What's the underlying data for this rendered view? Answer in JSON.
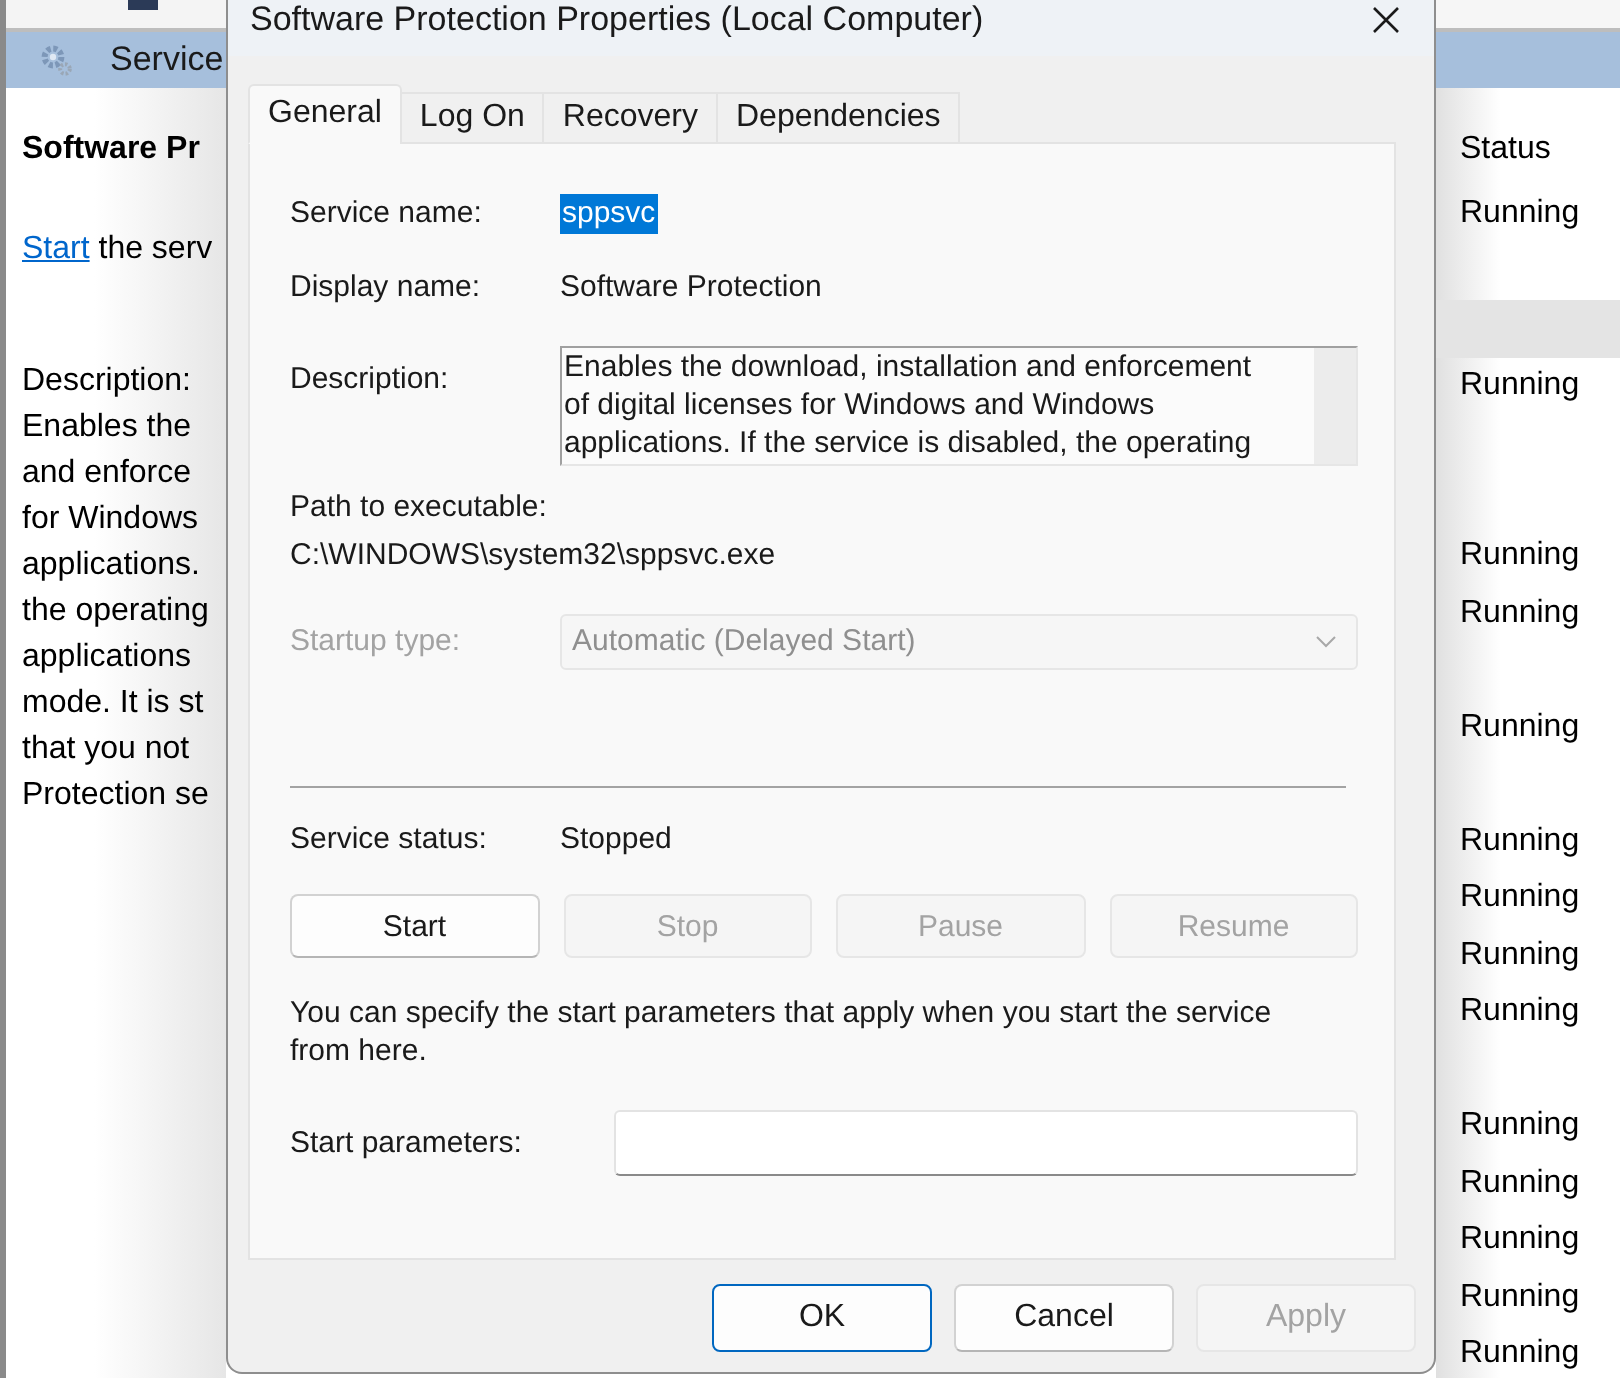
{
  "services_window": {
    "header": "Service",
    "selected_service": "Software Pr",
    "action": {
      "link": "Start",
      "text": "the serv"
    },
    "description_label": "Description:",
    "description_lines": [
      "Enables the",
      "and enforce",
      "for Windows",
      "applications.",
      "the operating",
      "applications",
      "mode. It is st",
      "that you not",
      "Protection se"
    ],
    "status_column": {
      "header": "Status",
      "rows": [
        {
          "status": "Running",
          "selected": false
        },
        {
          "selected": false
        },
        {
          "selected": true
        },
        {
          "status": "Running",
          "selected": false
        },
        {
          "selected": false
        },
        {
          "selected": false
        },
        {
          "status": "Running",
          "selected": false
        },
        {
          "status": "Running",
          "selected": false
        },
        {
          "selected": false
        },
        {
          "status": "Running",
          "selected": false
        },
        {
          "selected": false
        },
        {
          "status": "Running",
          "selected": false
        },
        {
          "status": "Running",
          "selected": false
        },
        {
          "status": "Running",
          "selected": false
        },
        {
          "status": "Running",
          "selected": false
        },
        {
          "selected": false
        },
        {
          "status": "Running",
          "selected": false
        },
        {
          "status": "Running",
          "selected": false
        },
        {
          "status": "Running",
          "selected": false
        },
        {
          "status": "Running",
          "selected": false
        },
        {
          "status": "Running",
          "selected": false
        }
      ]
    }
  },
  "dialog": {
    "title": "Software Protection Properties (Local Computer)",
    "tabs": [
      {
        "label": "General",
        "selected": true
      },
      {
        "label": "Log On",
        "selected": false
      },
      {
        "label": "Recovery",
        "selected": false
      },
      {
        "label": "Dependencies",
        "selected": false
      }
    ],
    "service_name": {
      "label": "Service name:",
      "value": "sppsvc",
      "selected": true
    },
    "display_name": {
      "label": "Display name:",
      "value": "Software Protection"
    },
    "description": {
      "label": "Description:",
      "value": "Enables the download, installation and enforcement of digital licenses for Windows and Windows applications. If the service is disabled, the operating"
    },
    "path": {
      "label": "Path to executable:",
      "value": "C:\\WINDOWS\\system32\\sppsvc.exe"
    },
    "startup_type": {
      "label": "Startup type:",
      "value": "Automatic (Delayed Start)",
      "disabled": true
    },
    "service_status": {
      "label": "Service status:",
      "value": "Stopped"
    },
    "service_buttons": [
      {
        "label": "Start",
        "disabled": false
      },
      {
        "label": "Stop",
        "disabled": true
      },
      {
        "label": "Pause",
        "disabled": true
      },
      {
        "label": "Resume",
        "disabled": true
      }
    ],
    "note": "You can specify the start parameters that apply when you start the service from here.",
    "start_parameters": {
      "label": "Start parameters:"
    },
    "buttons": [
      {
        "label": "OK",
        "default": true,
        "disabled": false
      },
      {
        "label": "Cancel",
        "default": false,
        "disabled": false
      },
      {
        "label": "Apply",
        "default": false,
        "disabled": true
      }
    ]
  }
}
